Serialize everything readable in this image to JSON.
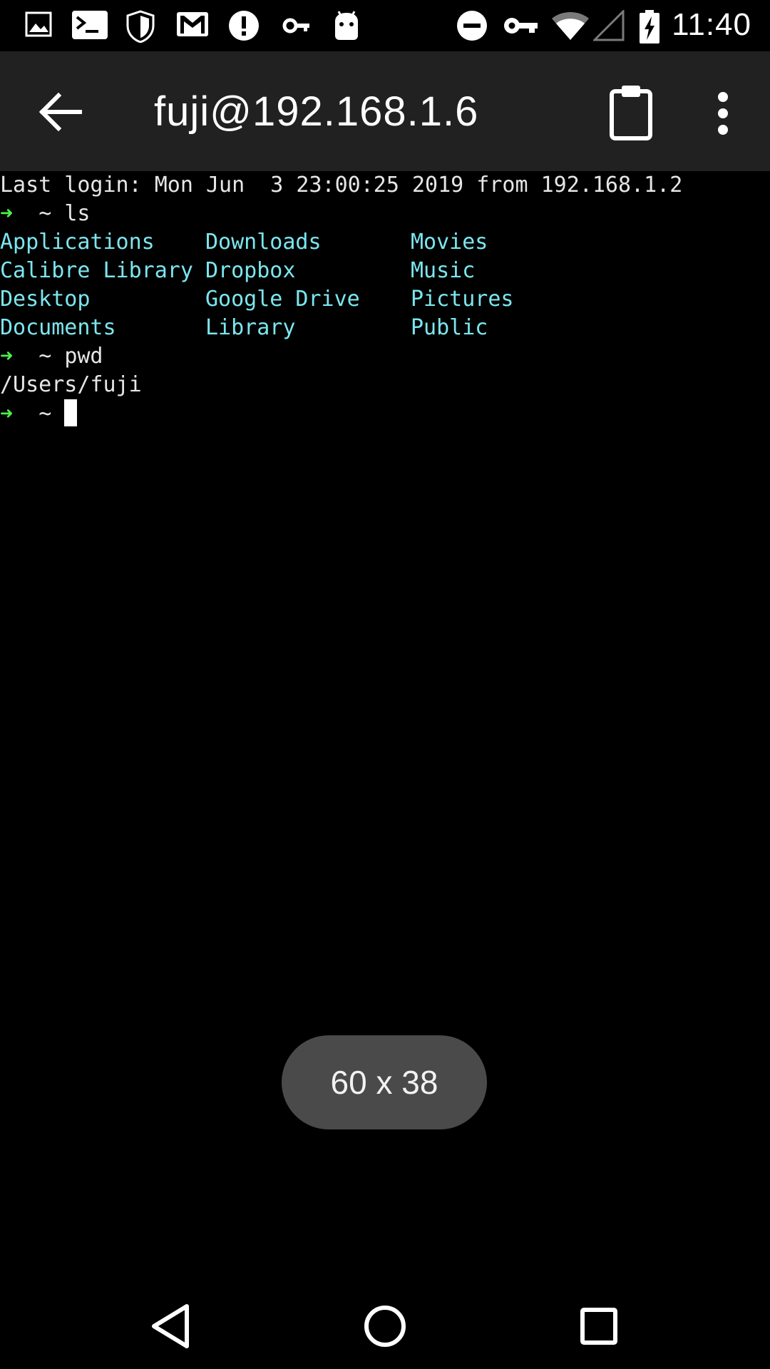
{
  "status_bar": {
    "time": "11:40",
    "left_icons": [
      "image-icon",
      "terminal-icon",
      "shield-icon",
      "gmail-icon",
      "alert-icon",
      "key-icon",
      "android-icon"
    ],
    "right_icons": [
      "do-not-disturb-icon",
      "vpn-key-icon",
      "wifi-icon",
      "cell-signal-icon",
      "battery-charging-icon"
    ]
  },
  "toolbar": {
    "title": "fuji@192.168.1.6"
  },
  "terminal": {
    "last_login": "Last login: Mon Jun  3 23:00:25 2019 from 192.168.1.2",
    "prompt_arrow": "➜",
    "prompt_dir": "~",
    "cmd1": "ls",
    "ls_columns": [
      [
        "Applications",
        "Calibre Library",
        "Desktop",
        "Documents"
      ],
      [
        "Downloads",
        "Dropbox",
        "Google Drive",
        "Library"
      ],
      [
        "Movies",
        "Music",
        "Pictures",
        "Public"
      ]
    ],
    "cmd2": "pwd",
    "pwd_output": "/Users/fuji",
    "colors": {
      "prompt_arrow": "#4cf04c",
      "directory": "#7be6ef",
      "text": "#e6e6e6"
    }
  },
  "toast": {
    "text": "60 x 38"
  },
  "nav_bar": {
    "buttons": [
      "back-icon",
      "home-icon",
      "recents-icon"
    ]
  }
}
